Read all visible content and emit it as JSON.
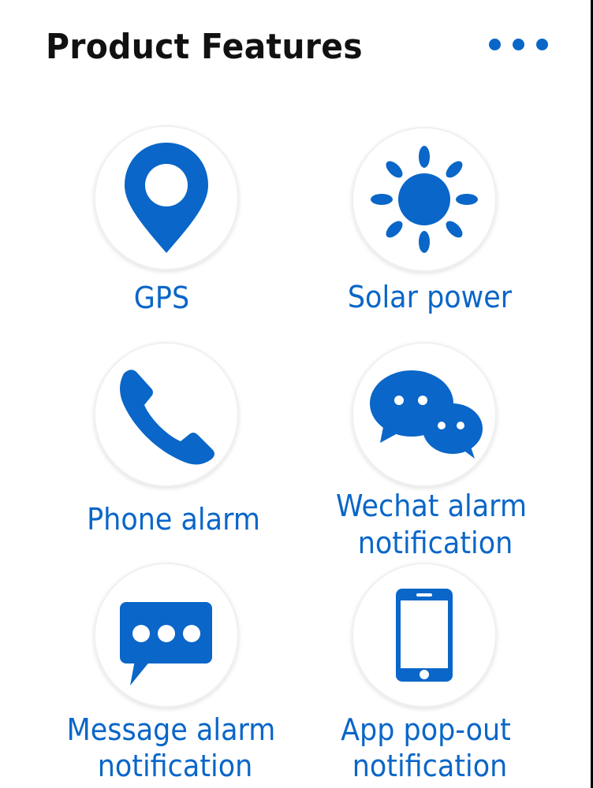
{
  "header": {
    "title": "Product Features",
    "more_icon": "more-horizontal-dots-icon"
  },
  "colors": {
    "accent": "#0a66c8",
    "title": "#111111",
    "background": "#ffffff"
  },
  "features": [
    {
      "icon": "location-pin-icon",
      "label_lines": [
        "GPS"
      ]
    },
    {
      "icon": "sun-icon",
      "label_lines": [
        "Solar power"
      ]
    },
    {
      "icon": "phone-handset-icon",
      "label_lines": [
        "Phone alarm"
      ]
    },
    {
      "icon": "wechat-icon",
      "label_lines": [
        "Wechat alarm",
        "notification"
      ]
    },
    {
      "icon": "message-bubble-icon",
      "label_lines": [
        "Message alarm",
        "notification"
      ]
    },
    {
      "icon": "smartphone-icon",
      "label_lines": [
        "App pop-out",
        "notification"
      ]
    }
  ]
}
